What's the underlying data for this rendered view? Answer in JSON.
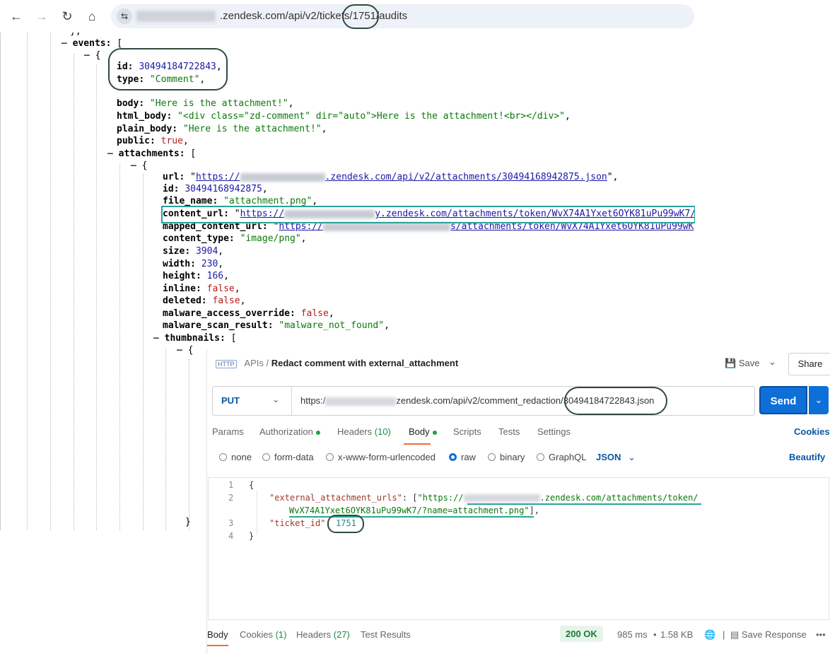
{
  "browser": {
    "url_visible": ".zendesk.com/api/v2/tickets/1751/audits",
    "back_icon": "←",
    "forward_icon": "→",
    "reload_icon": "↻",
    "home_icon": "⌂",
    "site_info_icon": "⇆"
  },
  "json_view": {
    "lines": {
      "events_key": "events",
      "id_key": "id",
      "id_value": "30494184722843",
      "type_key": "type",
      "type_value": "\"Comment\"",
      "body_key": "body",
      "body_value": "\"Here is the attachment!\"",
      "html_body_key": "html_body",
      "html_body_value": "\"<div class=\"zd-comment\" dir=\"auto\">Here is the attachment!<br></div>\"",
      "plain_body_key": "plain_body",
      "plain_body_value": "\"Here is the attachment!\"",
      "public_key": "public",
      "public_value": "true",
      "attachments_key": "attachments",
      "url_key": "url",
      "url_value_suffix": ".zendesk.com/api/v2/attachments/30494168942875.json",
      "url_value_prefix": "https://",
      "att_id_key": "id",
      "att_id_value": "30494168942875",
      "file_name_key": "file_name",
      "file_name_value": "\"attachment.png\"",
      "content_url_key": "content_url",
      "content_url_prefix": "https://",
      "content_url_suffix": "y.zendesk.com/attachments/token/WvX74A1Yxet6OYK81uPu99wK7/?",
      "mapped_content_url_key": "mapped_content_url",
      "mapped_content_url_prefix": "https://",
      "mapped_content_url_suffix": "s/attachments/token/WvX74A1Yxet6OYK81uPu99wK",
      "content_type_key": "content_type",
      "content_type_value": "\"image/png\"",
      "size_key": "size",
      "size_value": "3904",
      "width_key": "width",
      "width_value": "230",
      "height_key": "height",
      "height_value": "166",
      "inline_key": "inline",
      "inline_value": "false",
      "deleted_key": "deleted",
      "deleted_value": "false",
      "malware_access_override_key": "malware_access_override",
      "malware_access_override_value": "false",
      "malware_scan_result_key": "malware_scan_result",
      "malware_scan_result_value": "\"malware_not_found\"",
      "thumbnails_key": "thumbnails"
    }
  },
  "postman": {
    "breadcrumb_icon": "HTTP",
    "breadcrumb_parent": "APIs",
    "breadcrumb_sep": "/",
    "request_name": "Redact comment with external_attachment",
    "save_label": "Save",
    "share_label": "Share",
    "method": "PUT",
    "url_prefix": "https:/",
    "url_middle": "zendesk.com/api/v2/comment_redaction",
    "url_suffix": "/30494184722843.json",
    "send_label": "Send",
    "tabs": [
      {
        "label": "Params"
      },
      {
        "label": "Authorization"
      },
      {
        "label": "Headers",
        "count": "(10)"
      },
      {
        "label": "Body"
      },
      {
        "label": "Scripts"
      },
      {
        "label": "Tests"
      },
      {
        "label": "Settings"
      }
    ],
    "cookies_label": "Cookies",
    "body_modes": [
      "none",
      "form-data",
      "x-www-form-urlencoded",
      "raw",
      "binary",
      "GraphQL"
    ],
    "format_label": "JSON",
    "beautify_label": "Beautify",
    "editor": {
      "line_numbers": [
        "1",
        "2",
        "3",
        "4"
      ],
      "open_brace": "{",
      "close_brace": "}",
      "key1": "\"external_attachment_urls\"",
      "url_part1": "\"https://",
      "url_part2": ".zendesk.com/attachments/token/",
      "url_part3": "WvX74A1Yxet6OYK81uPu99wK7/?name=attachment.png",
      "key2": "\"ticket_id\"",
      "ticket_id_value": "1751"
    },
    "footer": {
      "tabs": [
        {
          "label": "Body"
        },
        {
          "label": "Cookies",
          "count": "(1)"
        },
        {
          "label": "Headers",
          "count": "(27)"
        },
        {
          "label": "Test Results"
        }
      ],
      "status": "200 OK",
      "time": "985 ms",
      "size": "1.58 KB",
      "save_response_label": "Save Response",
      "more_icon": "•••"
    }
  }
}
